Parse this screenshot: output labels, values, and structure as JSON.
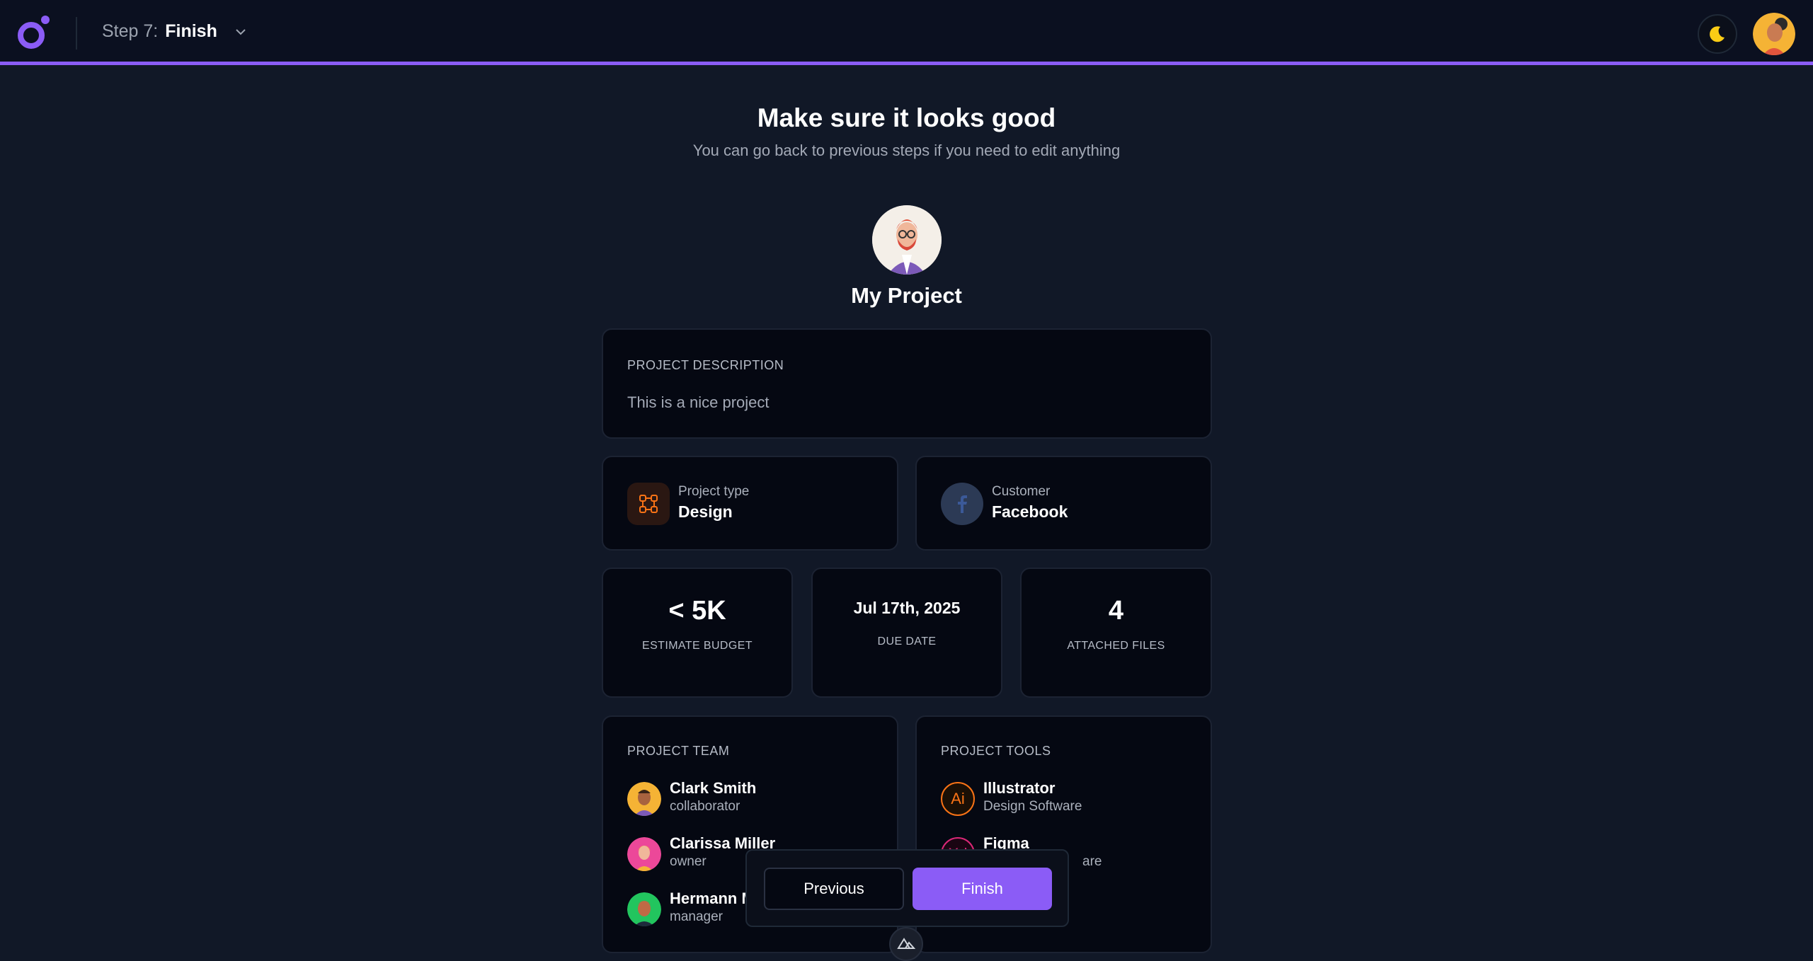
{
  "header": {
    "step_prefix": "Step 7:",
    "step_name": "Finish",
    "accent_color": "#8b5cf6"
  },
  "main": {
    "title": "Make sure it looks good",
    "subtitle": "You can go back to previous steps if you need to edit anything",
    "project_name": "My Project"
  },
  "description": {
    "label": "PROJECT DESCRIPTION",
    "text": "This is a nice project"
  },
  "project_type": {
    "label": "Project type",
    "value": "Design",
    "icon": "vector-design-icon"
  },
  "customer": {
    "label": "Customer",
    "value": "Facebook",
    "icon": "facebook-icon"
  },
  "stats": {
    "budget_value": "< 5K",
    "budget_label": "ESTIMATE BUDGET",
    "due_value": "Jul 17th, 2025",
    "due_label": "DUE DATE",
    "files_value": "4",
    "files_label": "ATTACHED FILES"
  },
  "team": {
    "label": "PROJECT TEAM",
    "members": [
      {
        "name": "Clark Smith",
        "role": "collaborator"
      },
      {
        "name": "Clarissa Miller",
        "role": "owner"
      },
      {
        "name": "Hermann M",
        "role": "manager"
      }
    ]
  },
  "tools": {
    "label": "PROJECT TOOLS",
    "items": [
      {
        "name": "Illustrator",
        "type": "Design Software",
        "icon": "illustrator-icon"
      },
      {
        "name": "Figma",
        "type": "are",
        "icon": "xd-icon"
      }
    ]
  },
  "actions": {
    "previous_label": "Previous",
    "finish_label": "Finish"
  }
}
